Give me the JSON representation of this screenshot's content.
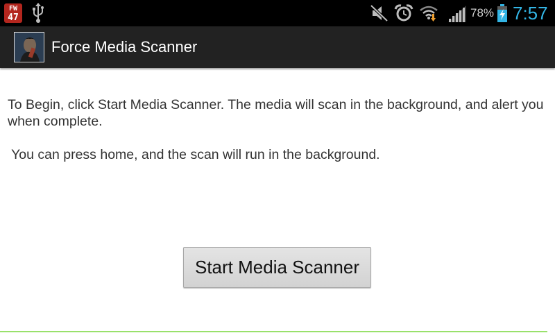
{
  "status_bar": {
    "notification_badge": {
      "line1": "FW",
      "line2": "47"
    },
    "icons": [
      "usb-icon",
      "mute-icon",
      "alarm-icon",
      "wifi-icon",
      "signal-icon",
      "battery-charging-icon"
    ],
    "battery_percent": "78%",
    "clock": "7:57",
    "clock_color": "#33b5e5"
  },
  "action_bar": {
    "title": "Force Media Scanner",
    "background": "#222222"
  },
  "content": {
    "paragraph1": "To Begin, click Start Media Scanner. The media will scan in the background, and alert you when complete.",
    "paragraph2": " You can press home, and the scan will run in the background."
  },
  "start_button": {
    "label": "Start Media Scanner"
  }
}
